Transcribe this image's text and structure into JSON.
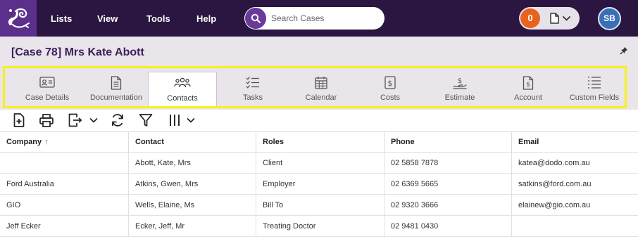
{
  "nav": {
    "items": [
      {
        "label": "Lists"
      },
      {
        "label": "View"
      },
      {
        "label": "Tools"
      },
      {
        "label": "Help"
      }
    ],
    "search_placeholder": "Search Cases",
    "notification_count": "0",
    "user_initials": "SB"
  },
  "case": {
    "title": "[Case 78] Mrs Kate Abott"
  },
  "tabs": [
    {
      "label": "Case Details",
      "icon": "id-card-icon"
    },
    {
      "label": "Documentation",
      "icon": "document-icon"
    },
    {
      "label": "Contacts",
      "icon": "people-icon",
      "active": true
    },
    {
      "label": "Tasks",
      "icon": "checklist-icon"
    },
    {
      "label": "Calendar",
      "icon": "calendar-icon"
    },
    {
      "label": "Costs",
      "icon": "dollar-box-icon"
    },
    {
      "label": "Estimate",
      "icon": "dollar-hand-icon"
    },
    {
      "label": "Account",
      "icon": "dollar-doc-icon"
    },
    {
      "label": "Custom Fields",
      "icon": "list-icon"
    }
  ],
  "toolbar": {
    "icons": [
      "add-icon",
      "print-icon",
      "export-icon",
      "refresh-icon",
      "filter-icon",
      "columns-icon"
    ]
  },
  "grid": {
    "columns": [
      "Company",
      "Contact",
      "Roles",
      "Phone",
      "Email"
    ],
    "sort_column": "Company",
    "rows": [
      {
        "company": "",
        "contact": "Abott, Kate, Mrs",
        "role": "Client",
        "phone": "02 5858 7878",
        "email": "katea@dodo.com.au"
      },
      {
        "company": "Ford Australia",
        "contact": "Atkins, Gwen, Mrs",
        "role": "Employer",
        "phone": "02 6369 5665",
        "email": "satkins@ford.com.au"
      },
      {
        "company": "GIO",
        "contact": "Wells, Elaine, Ms",
        "role": "Bill To",
        "phone": "02 9320 3666",
        "email": "elainew@gio.com.au"
      },
      {
        "company": "Jeff Ecker",
        "contact": "Ecker, Jeff, Mr",
        "role": "Treating Doctor",
        "phone": "02 9481 0430",
        "email": ""
      }
    ]
  },
  "colors": {
    "topbar": "#2a1640",
    "brand_purple": "#5b2f8c",
    "accent_orange": "#e8631e",
    "highlight_yellow": "#f7f214"
  }
}
